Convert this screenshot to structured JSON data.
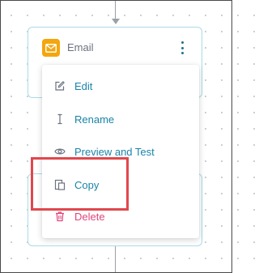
{
  "node": {
    "title": "Email",
    "icon": "envelope-icon",
    "accent": "#f4a60d"
  },
  "menu": {
    "items": [
      {
        "label": "Edit",
        "icon": "edit-icon"
      },
      {
        "label": "Rename",
        "icon": "text-cursor-icon"
      },
      {
        "label": "Preview and Test",
        "icon": "eye-icon"
      },
      {
        "label": "Copy",
        "icon": "copy-icon"
      },
      {
        "label": "Delete",
        "icon": "trash-icon"
      }
    ]
  },
  "colors": {
    "link": "#1a85a8",
    "danger": "#e0457b",
    "highlight": "#e0474c"
  }
}
